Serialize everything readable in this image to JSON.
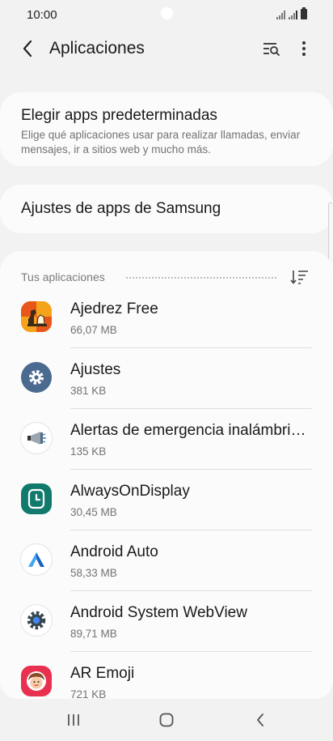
{
  "status_bar": {
    "time": "10:00",
    "icons": [
      "signal-icon",
      "signal-icon",
      "battery-icon"
    ]
  },
  "app_bar": {
    "title": "Aplicaciones",
    "icons": [
      "back-arrow-icon",
      "search-list-icon",
      "more-vert-icon"
    ]
  },
  "default_apps": {
    "title": "Elegir apps predeterminadas",
    "description": "Elige qué aplicaciones usar para realizar llamadas, enviar mensajes, ir a sitios web y mucho más."
  },
  "samsung_apps": {
    "title": "Ajustes de apps de Samsung"
  },
  "your_apps": {
    "header": "Tus aplicaciones",
    "sort_icon": "sort-icon",
    "items": [
      {
        "name": "Ajedrez Free",
        "size": "66,07 MB",
        "icon": "chess-app-icon"
      },
      {
        "name": "Ajustes",
        "size": "381 KB",
        "icon": "settings-gear-icon"
      },
      {
        "name": "Alertas de emergencia inalámbricas",
        "size": "135 KB",
        "icon": "megaphone-icon"
      },
      {
        "name": "AlwaysOnDisplay",
        "size": "30,45 MB",
        "icon": "clock-icon"
      },
      {
        "name": "Android Auto",
        "size": "58,33 MB",
        "icon": "android-auto-icon"
      },
      {
        "name": "Android System WebView",
        "size": "89,71 MB",
        "icon": "webview-gear-icon"
      },
      {
        "name": "AR Emoji",
        "size": "721 KB",
        "icon": "ar-emoji-icon"
      }
    ]
  },
  "nav_bar": {
    "icons": [
      "recents-icon",
      "home-icon",
      "back-icon"
    ]
  },
  "colors": {
    "background": "#f2f2f2",
    "card": "#fbfbfb",
    "secondary_text": "#737373"
  }
}
